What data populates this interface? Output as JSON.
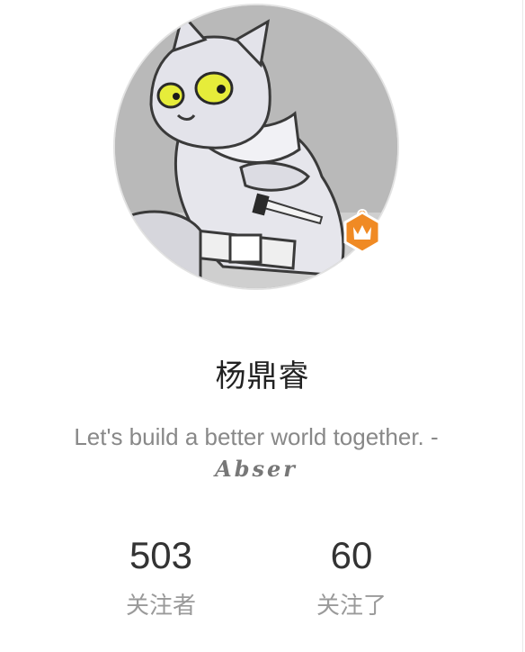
{
  "profile": {
    "name": "杨鼎睿",
    "bio_text": "Let's build a better world together. -",
    "bio_signature": "Abser",
    "badge_icon": "crown-icon",
    "badge_color": "#f08a24"
  },
  "stats": [
    {
      "value": "503",
      "label": "关注者"
    },
    {
      "value": "60",
      "label": "关注了"
    }
  ],
  "colors": {
    "background": "#ffffff",
    "name_text": "#222222",
    "muted_text": "#888888"
  }
}
